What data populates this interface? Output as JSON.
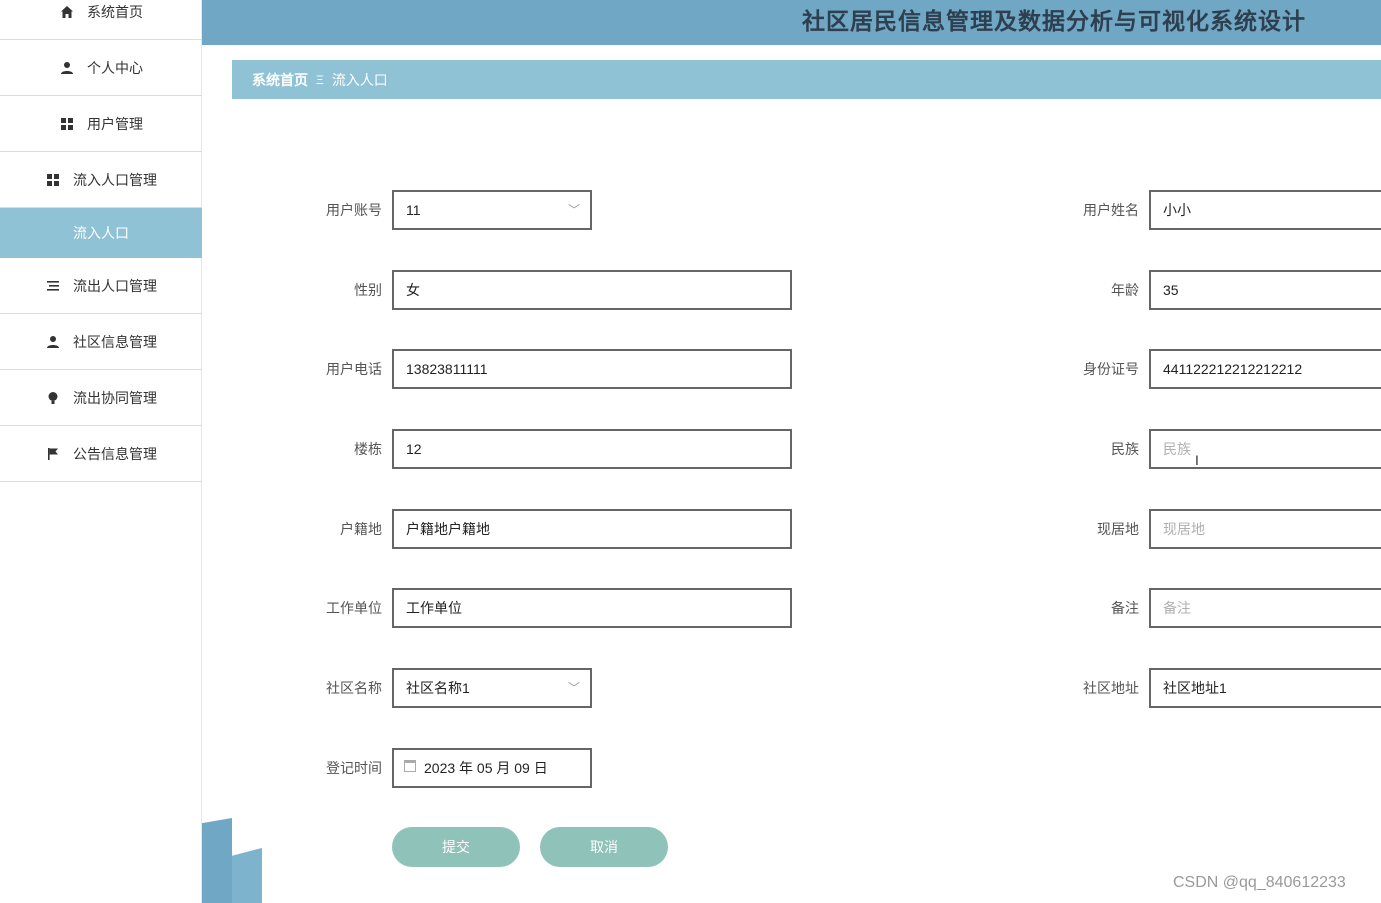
{
  "header": {
    "title": "社区居民信息管理及数据分析与可视化系统设计"
  },
  "sidebar": {
    "items": [
      {
        "label": "系统首页",
        "icon": "home-icon"
      },
      {
        "label": "个人中心",
        "icon": "user-icon"
      },
      {
        "label": "用户管理",
        "icon": "grid-icon"
      },
      {
        "label": "流入人口管理",
        "icon": "grid-icon"
      },
      {
        "label": "流入人口",
        "icon": ""
      },
      {
        "label": "流出人口管理",
        "icon": "list-icon"
      },
      {
        "label": "社区信息管理",
        "icon": "user-icon"
      },
      {
        "label": "流出协同管理",
        "icon": "bulb-icon"
      },
      {
        "label": "公告信息管理",
        "icon": "flag-icon"
      }
    ]
  },
  "breadcrumb": {
    "home": "系统首页",
    "separator": "Ξ",
    "current": "流入人口"
  },
  "form": {
    "account_label": "用户账号",
    "account_value": "11",
    "name_label": "用户姓名",
    "name_value": "小小",
    "gender_label": "性别",
    "gender_value": "女",
    "age_label": "年龄",
    "age_value": "35",
    "phone_label": "用户电话",
    "phone_value": "13823811111",
    "idcard_label": "身份证号",
    "idcard_value": "441122212212212212",
    "building_label": "楼栋",
    "building_value": "12",
    "ethnic_label": "民族",
    "ethnic_placeholder": "民族",
    "hukou_label": "户籍地",
    "hukou_value": "户籍地户籍地",
    "residence_label": "现居地",
    "residence_placeholder": "现居地",
    "work_label": "工作单位",
    "work_value": "工作单位",
    "remark_label": "备注",
    "remark_placeholder": "备注",
    "community_label": "社区名称",
    "community_value": "社区名称1",
    "address_label": "社区地址",
    "address_value": "社区地址1",
    "regtime_label": "登记时间",
    "regtime_value": "2023 年 05 月 09 日"
  },
  "buttons": {
    "submit": "提交",
    "cancel": "取消"
  },
  "watermark": "CSDN @qq_840612233",
  "colors": {
    "header": "#6fa7c4",
    "accent": "#8fc2d4",
    "button": "#8fc2b8"
  }
}
